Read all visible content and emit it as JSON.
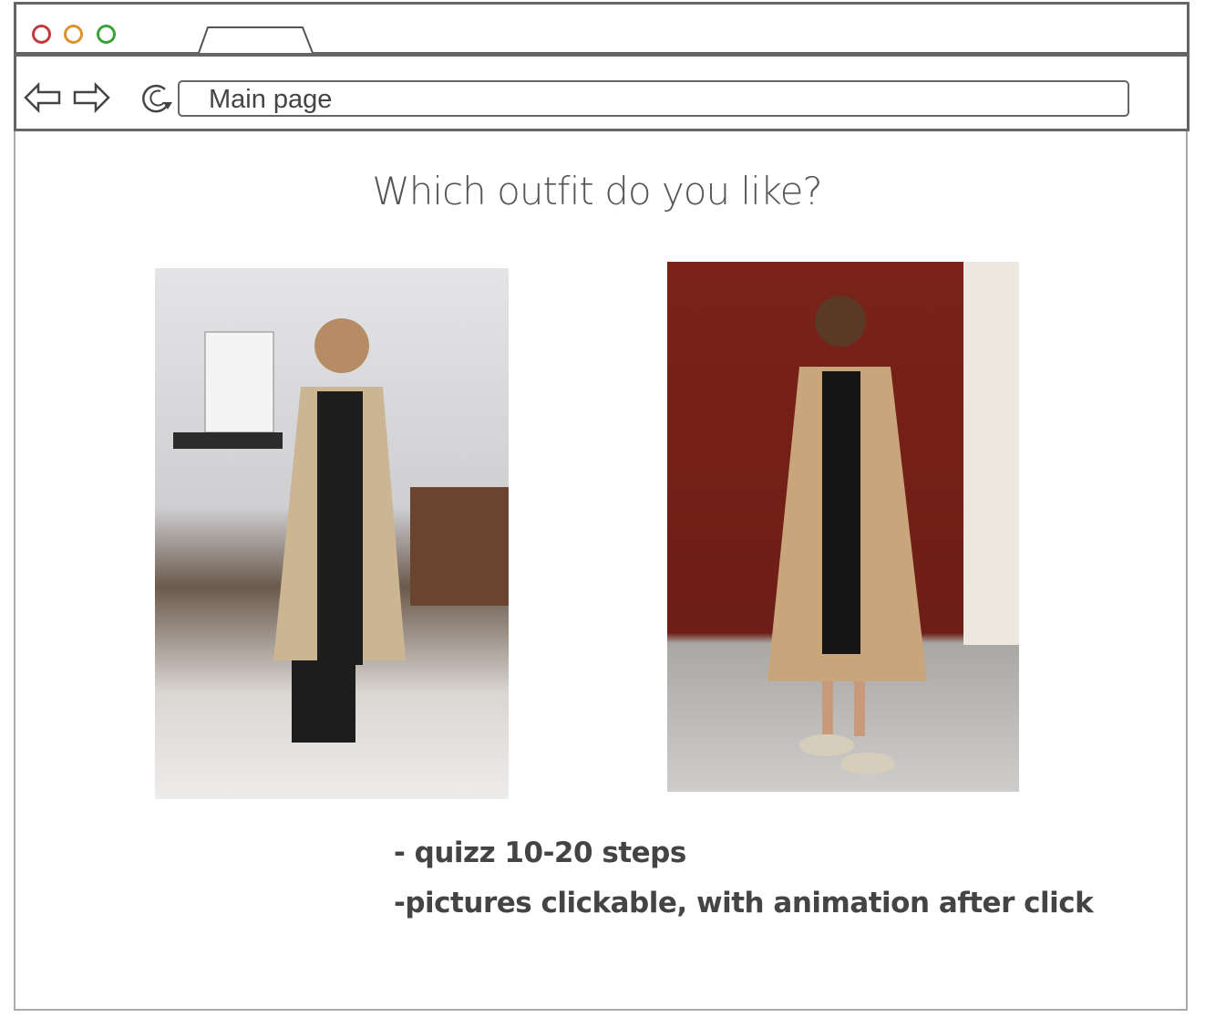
{
  "browser": {
    "window_controls": [
      {
        "name": "close",
        "color": "#c0393b"
      },
      {
        "name": "minimize",
        "color": "#e0922a"
      },
      {
        "name": "maximize",
        "color": "#3aa23a"
      }
    ],
    "address": "Main page",
    "icons": [
      "back-arrow-icon",
      "forward-arrow-icon",
      "refresh-icon"
    ]
  },
  "main": {
    "title": "Which outfit do you like?",
    "options": [
      {
        "description": "Woman in beige trench coat, black top and jeans, indoor mirror selfie"
      },
      {
        "description": "Woman in beige trench coat and black dress in front of red door"
      }
    ],
    "notes": [
      "- quizz 10-20 steps",
      "-pictures clickable, with animation after click"
    ]
  }
}
